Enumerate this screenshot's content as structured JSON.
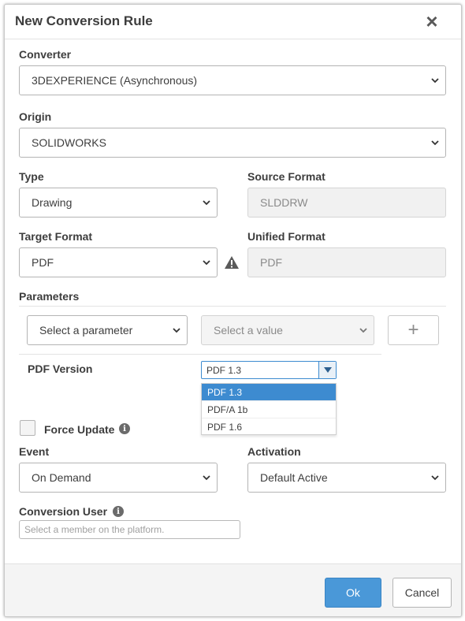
{
  "dialog": {
    "title": "New Conversion Rule"
  },
  "icons": {
    "close": "close-icon",
    "chevron": "chevron-down-icon",
    "warning": "warning-icon",
    "info": "info-icon"
  },
  "colors": {
    "primary": "#4a98d8",
    "selected_option": "#3d8bd0",
    "readonly_bg": "#f1f1f1"
  },
  "converter": {
    "label": "Converter",
    "value": "3DEXPERIENCE (Asynchronous)"
  },
  "origin": {
    "label": "Origin",
    "value": "SOLIDWORKS"
  },
  "type": {
    "label": "Type",
    "value": "Drawing"
  },
  "source_format": {
    "label": "Source Format",
    "value": "SLDDRW"
  },
  "target_format": {
    "label": "Target Format",
    "value": "PDF"
  },
  "unified_format": {
    "label": "Unified Format",
    "value": "PDF"
  },
  "parameters": {
    "label": "Parameters",
    "param_select": "Select a parameter",
    "value_select": "Select a value",
    "add_label": "+",
    "pdf_version": {
      "label": "PDF Version",
      "value": "PDF 1.3",
      "options": [
        "PDF 1.3",
        "PDF/A 1b",
        "PDF 1.6"
      ]
    }
  },
  "force_update": {
    "label": "Force Update",
    "info": "i"
  },
  "event": {
    "label": "Event",
    "value": "On Demand"
  },
  "activation": {
    "label": "Activation",
    "value": "Default Active"
  },
  "conversion_user": {
    "label": "Conversion User",
    "info": "i",
    "placeholder": "Select a member on the platform."
  },
  "footer": {
    "ok_label": "Ok",
    "cancel_label": "Cancel"
  }
}
